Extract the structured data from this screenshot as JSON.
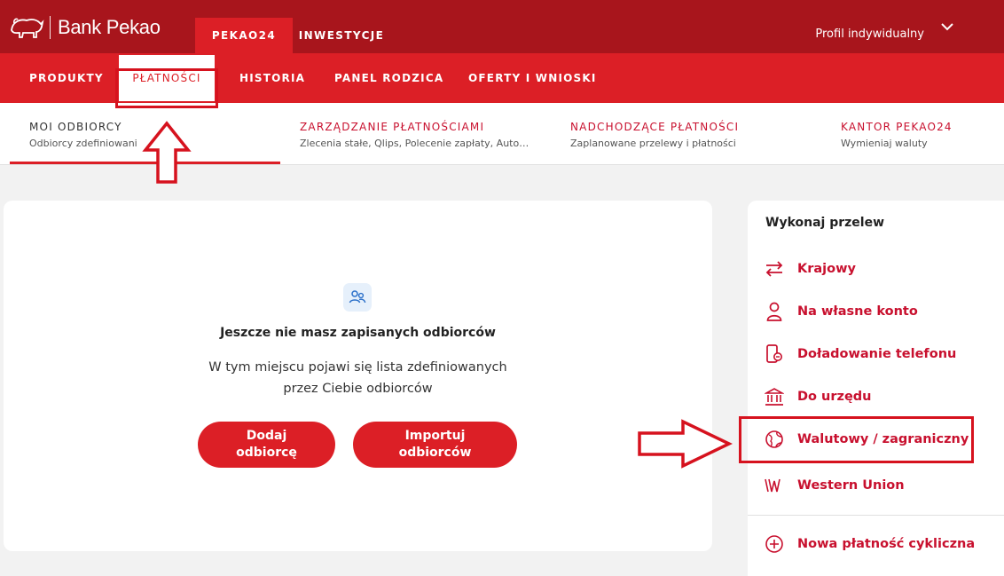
{
  "header": {
    "brand": "Bank Pekao",
    "tabs": [
      {
        "label": "PEKAO24",
        "active": true
      },
      {
        "label": "INWESTYCJE",
        "active": false
      }
    ],
    "profile": "Profil indywidualny"
  },
  "subnav": {
    "items": [
      {
        "label": "PRODUKTY"
      },
      {
        "label": "PŁATNOŚCI",
        "active": true
      },
      {
        "label": "HISTORIA"
      },
      {
        "label": "PANEL RODZICA"
      },
      {
        "label": "OFERTY I WNIOSKI"
      }
    ]
  },
  "thirdnav": {
    "items": [
      {
        "title": "MOI ODBIORCY",
        "subtitle": "Odbiorcy zdefiniowani",
        "active": true
      },
      {
        "title": "ZARZĄDZANIE PŁATNOŚCIAMI",
        "subtitle": "Zlecenia stałe, Qlips, Polecenie zapłaty, Autostr..."
      },
      {
        "title": "NADCHODZĄCE PŁATNOŚCI",
        "subtitle": "Zaplanowane przelewy i płatności"
      },
      {
        "title": "KANTOR PEKAO24",
        "subtitle": "Wymieniaj waluty"
      }
    ]
  },
  "main": {
    "empty_title": "Jeszcze nie masz zapisanych odbiorców",
    "empty_desc_line1": "W tym miejscu pojawi się lista zdefiniowanych",
    "empty_desc_line2": "przez Ciebie odbiorców",
    "add_button_line1": "Dodaj",
    "add_button_line2": "odbiorcę",
    "import_button_line1": "Importuj",
    "import_button_line2": "odbiorców"
  },
  "side": {
    "title": "Wykonaj przelew",
    "items": [
      {
        "label": "Krajowy",
        "icon": "transfer-arrows-icon"
      },
      {
        "label": "Na własne konto",
        "icon": "person-icon"
      },
      {
        "label": "Doładowanie telefonu",
        "icon": "phone-topup-icon"
      },
      {
        "label": "Do urzędu",
        "icon": "government-building-icon"
      },
      {
        "label": "Walutowy / zagraniczny",
        "icon": "globe-icon"
      },
      {
        "label": "Western Union",
        "icon": "western-union-icon"
      },
      {
        "label": "Nowa płatność cykliczna",
        "icon": "plus-circle-icon"
      }
    ]
  },
  "colors": {
    "header_dark": "#a8151c",
    "header_red": "#dc1f26",
    "accent": "#c8102e"
  }
}
